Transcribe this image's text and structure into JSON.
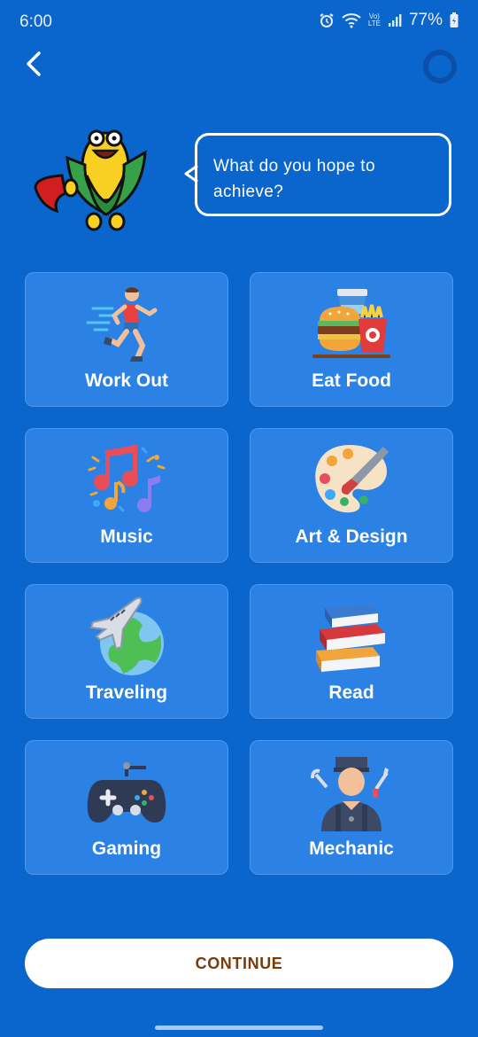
{
  "status_bar": {
    "time": "6:00",
    "lte_top": "Vo)",
    "lte_bottom": "LTE",
    "battery": "77%"
  },
  "prompt": "What do you hope to achieve?",
  "options": [
    {
      "label": "Work Out",
      "icon": "runner-icon"
    },
    {
      "label": "Eat Food",
      "icon": "fast-food-icon"
    },
    {
      "label": "Music",
      "icon": "music-notes-icon"
    },
    {
      "label": "Art & Design",
      "icon": "paint-palette-icon"
    },
    {
      "label": "Traveling",
      "icon": "airplane-globe-icon"
    },
    {
      "label": "Read",
      "icon": "books-icon"
    },
    {
      "label": "Gaming",
      "icon": "gamepad-icon"
    },
    {
      "label": "Mechanic",
      "icon": "mechanic-icon"
    }
  ],
  "continue_label": "CONTINUE",
  "colors": {
    "background": "#0a66cc",
    "tile": "#2b82e4",
    "button_text": "#7a3b0b"
  }
}
